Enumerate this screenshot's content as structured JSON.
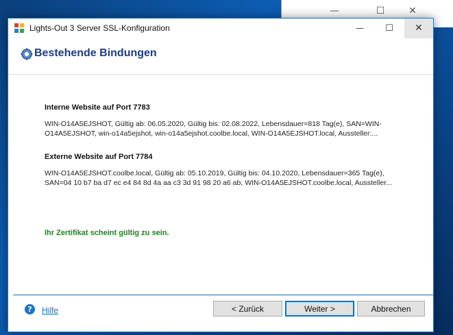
{
  "background_window": {
    "minimize": "—",
    "maximize": "☐",
    "close": "✕"
  },
  "window": {
    "title": "Lights-Out 3 Server SSL-Konfiguration",
    "minimize": "—",
    "maximize": "☐",
    "close": "✕"
  },
  "header": {
    "title": "Bestehende Bindungen",
    "icon": "gear-icon"
  },
  "sections": [
    {
      "title": "Interne Website auf Port 7783",
      "line1": "WIN-O14A5EJSHOT, Gültig ab: 06.05.2020, Gültig bis: 02.08.2022, Lebensdauer=818 Tag(e), SAN=WIN-",
      "line2": "O14A5EJSHOT, win-o14a5ejshot, win-o14a5ejshot.coolbe.local, WIN-O14A5EJSHOT.local, Aussteller:..."
    },
    {
      "title": "Externe Website auf Port 7784",
      "line1": "WIN-O14A5EJSHOT.coolbe.local, Gültig ab: 05.10.2019, Gültig bis: 04.10.2020, Lebensdauer=365 Tag(e),",
      "line2": "SAN=04 10 b7 ba d7 ec e4 84 8d 4a aa c3 3d 91 98 20 a6 ab, WIN-O14A5EJSHOT.coolbe.local, Aussteller..."
    }
  ],
  "status": "Ihr Zertifikat scheint gültig zu sein.",
  "footer": {
    "help_icon": "?",
    "help_label": "Hilfe",
    "back_label": "< Zurück",
    "next_label": "Weiter >",
    "cancel_label": "Abbrechen"
  },
  "colors": {
    "header_title": "#1a3c8c",
    "status_ok": "#1a8a1a",
    "link": "#1e6fc8",
    "accent": "#0078d7"
  }
}
